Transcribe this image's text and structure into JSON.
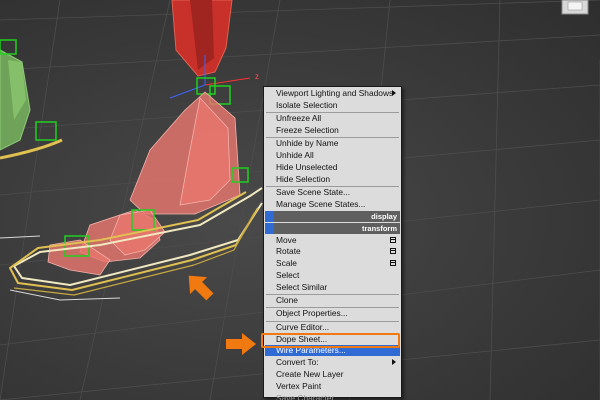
{
  "viewport": {
    "name": "3D viewport",
    "colors": {
      "background": "#3a3a3a",
      "grid": "#505050",
      "selected_geometry": "#e8706a",
      "spline_highlight": "#e0d070",
      "gizmo_box": "#20d020",
      "callout_arrow": "#f07a10",
      "menu_highlight": "#2f6bd3"
    },
    "gizmo_axis_label": "z"
  },
  "quad_menu": {
    "items": [
      {
        "label": "Viewport Lighting and Shadows",
        "submenu": true
      },
      {
        "label": "Isolate Selection"
      },
      {
        "separator": true
      },
      {
        "label": "Unfreeze All"
      },
      {
        "label": "Freeze Selection"
      },
      {
        "separator": true
      },
      {
        "label": "Unhide by Name"
      },
      {
        "label": "Unhide All"
      },
      {
        "label": "Hide Unselected"
      },
      {
        "label": "Hide Selection"
      },
      {
        "separator": true
      },
      {
        "label": "Save Scene State..."
      },
      {
        "label": "Manage Scene States..."
      }
    ],
    "display_header": "display",
    "transform_header": "transform",
    "transform_items": [
      {
        "label": "Move",
        "settings_box": true
      },
      {
        "label": "Rotate",
        "settings_box": true
      },
      {
        "label": "Scale",
        "settings_box": true
      },
      {
        "label": "Select"
      },
      {
        "label": "Select Similar"
      },
      {
        "separator": true
      },
      {
        "label": "Clone"
      },
      {
        "separator": true
      },
      {
        "label": "Object Properties..."
      },
      {
        "separator": true
      },
      {
        "label": "Curve Editor..."
      },
      {
        "label": "Dope Sheet..."
      },
      {
        "label": "Wire Parameters...",
        "highlighted": true
      },
      {
        "label": "Convert To:",
        "submenu": true
      },
      {
        "label": "Create New Layer"
      },
      {
        "label": "Vertex Paint"
      },
      {
        "label": "Save Character...",
        "disabled": true
      }
    ]
  }
}
